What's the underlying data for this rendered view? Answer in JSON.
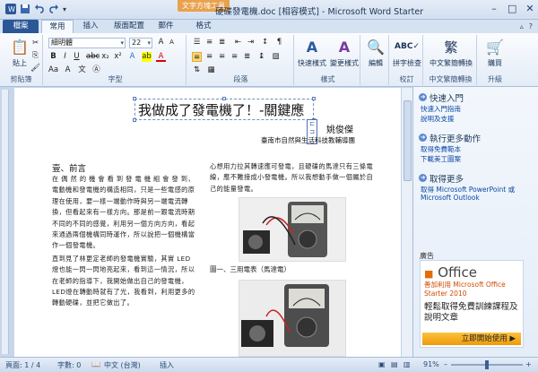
{
  "window": {
    "title": "硬碟發電機.doc [相容模式] - Microsoft Word Starter",
    "context_tab_label": "文字方塊工具",
    "controls": [
      "–",
      "□",
      "✕"
    ]
  },
  "tabs": [
    {
      "label": "檔案"
    },
    {
      "label": "常用"
    },
    {
      "label": "插入"
    },
    {
      "label": "版面配置"
    },
    {
      "label": "郵件"
    },
    {
      "label": "格式"
    }
  ],
  "ribbon": {
    "clipboard": {
      "paste_label": "貼上",
      "group_label": "剪貼簿"
    },
    "font": {
      "font_name": "細明體",
      "font_size": "22",
      "group_label": "字型"
    },
    "paragraph": {
      "group_label": "段落"
    },
    "styles": {
      "quick_styles": "快速樣式",
      "change_styles": "變更樣式",
      "group_label": "樣式"
    },
    "editing": {
      "label": "編輯"
    },
    "proofing": {
      "spelling": "拼字檢查",
      "group_label": "校訂"
    },
    "chinese": {
      "convert": "中文繁簡轉換",
      "group_label": "中文繁簡轉換"
    },
    "upgrade": {
      "purchase": "購買",
      "group_label": "升級"
    }
  },
  "document": {
    "title": "我做成了發電機了！-關鍵應",
    "author": "姚俊傑",
    "school": "臺南市自然與生活科技教輔導團",
    "section_head": "壹、前言",
    "left_para": "在 偶 然 的 機 會 看 到 發 電 機 組 會 發 到，電動機和發電機的構造相同，只是一些電感的原理在使用，要一樣一端動作時與另一端電流轉換，但看起來有一樣方向。那是前一跟電流時期不同的不同的感覺，利用另一個方向方向，看起來通過兩個機構同時運作，所以說把一個機構當作一個發電機。",
    "left_para2": "直到見了林更定老師的發電機實驗，其實 LED 燈也能一閃一閃地亮起來，看到這一情況，所以在老師的指導下，我開始做出自己的發電機，LED燈在轉動時就有了光，我看到，利用更多的轉動硬碟，並把它做出了。",
    "right_para": "心想用力拉其轉速應可發電，且硬碟的馬達只有三條電線，應不難接成小發電機。所以我想動手做一個屬於自己的能量發電。",
    "caption": "圖一、三用電表（馬達電）"
  },
  "pane": {
    "sections": [
      {
        "title": "快速入門",
        "links": [
          "快速入門指南",
          "說明及支援"
        ]
      },
      {
        "title": "執行更多動作",
        "links": [
          "取得免費範本",
          "下載美工圖案"
        ]
      },
      {
        "title": "取得更多",
        "links": [
          "取得 Microsoft PowerPoint 或",
          "Microsoft Outlook"
        ]
      }
    ],
    "ad_label": "廣告",
    "ad": {
      "brand": "Office",
      "line1": "善加利用 Microsoft Office Starter 2010",
      "line2": "輕鬆取得免費訓練課程及說明文章",
      "button": "立即開始使用 ▶"
    }
  },
  "status": {
    "page": "頁面: 1 / 4",
    "words": "字數: 0",
    "language": "中文 (台灣)",
    "mode": "插入",
    "zoom": "91%"
  },
  "colors": {
    "file_tab": "#2b5797",
    "ribbon_bg": "#e3ecf7",
    "context_tab": "#e8a24d"
  }
}
